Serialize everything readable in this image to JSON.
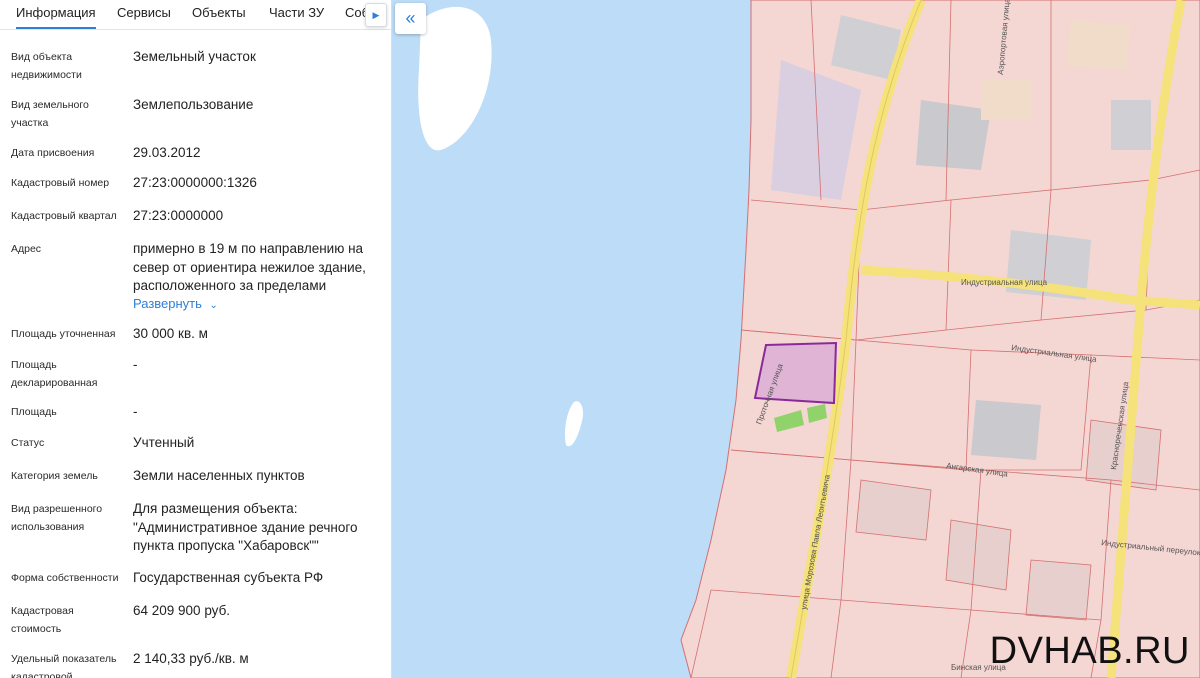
{
  "tabs": [
    {
      "label": "Информация",
      "active": true
    },
    {
      "label": "Сервисы",
      "active": false
    },
    {
      "label": "Объекты",
      "active": false
    },
    {
      "label": "Части ЗУ",
      "active": false
    },
    {
      "label": "Соб",
      "active": false
    }
  ],
  "info": {
    "object_type": {
      "label": "Вид объекта\nнедвижимости",
      "value": "Земельный участок"
    },
    "parcel_type": {
      "label": "Вид земельного\nучастка",
      "value": "Землепользование"
    },
    "assigned_date": {
      "label": "Дата присвоения",
      "value": "29.03.2012"
    },
    "cadastral_number": {
      "label": "Кадастровый номер",
      "value": "27:23:0000000:1326"
    },
    "cadastral_block": {
      "label": "Кадастровый квартал",
      "value": "27:23:0000000"
    },
    "address": {
      "label": "Адрес",
      "value": "примерно в 19 м по направлению на север от ориентира нежилое здание, расположенного за пределами",
      "expand_label": "Развернуть"
    },
    "area_specified": {
      "label": "Площадь уточненная",
      "value": "30 000 кв. м"
    },
    "area_declared": {
      "label": "Площадь\nдекларированная",
      "value": "-"
    },
    "area": {
      "label": "Площадь",
      "value": "-"
    },
    "status": {
      "label": "Статус",
      "value": "Учтенный"
    },
    "land_category": {
      "label": "Категория земель",
      "value": "Земли населенных пунктов"
    },
    "permitted_use": {
      "label": "Вид разрешенного\nиспользования",
      "value": "Для размещения объекта: \"Административное здание речного пункта пропуска \"Хабаровск\"\""
    },
    "ownership": {
      "label": "Форма собственности",
      "value": "Государственная субъекта РФ"
    },
    "cadastral_value": {
      "label": "Кадастровая\nстоимость",
      "value": "64 209 900 руб."
    },
    "unit_value": {
      "label": "Удельный показатель\nкадастровой",
      "value": "2 140,33 руб./кв. м"
    }
  },
  "map": {
    "streets": {
      "industrial": "Индустриальная улица",
      "industrial_2": "Индустриальная улица",
      "protochnaya": "Проточная улица",
      "morozova": "улица Морозова Павла Леонтьевича",
      "krasnorechenskaya": "Краснореченская улица",
      "angarskaya": "Ангарская улица",
      "industrial_lane": "Индустриальный переулок",
      "binskaya": "Бинская улица",
      "aeroport": "Аэропортовая улица"
    },
    "colors": {
      "water": "#bcdcf7",
      "land": "#f4d6d3",
      "parcel_fill": "#d8a8d6",
      "parcel_stroke": "#8a2a9a",
      "boundary": "#d47070",
      "road": "#f5e27a"
    }
  },
  "watermark": "DVHAB.RU",
  "icons": {
    "tab_next": "chevron-right-icon",
    "collapse": "double-chevron-left-icon",
    "expand": "chevron-down-icon"
  }
}
